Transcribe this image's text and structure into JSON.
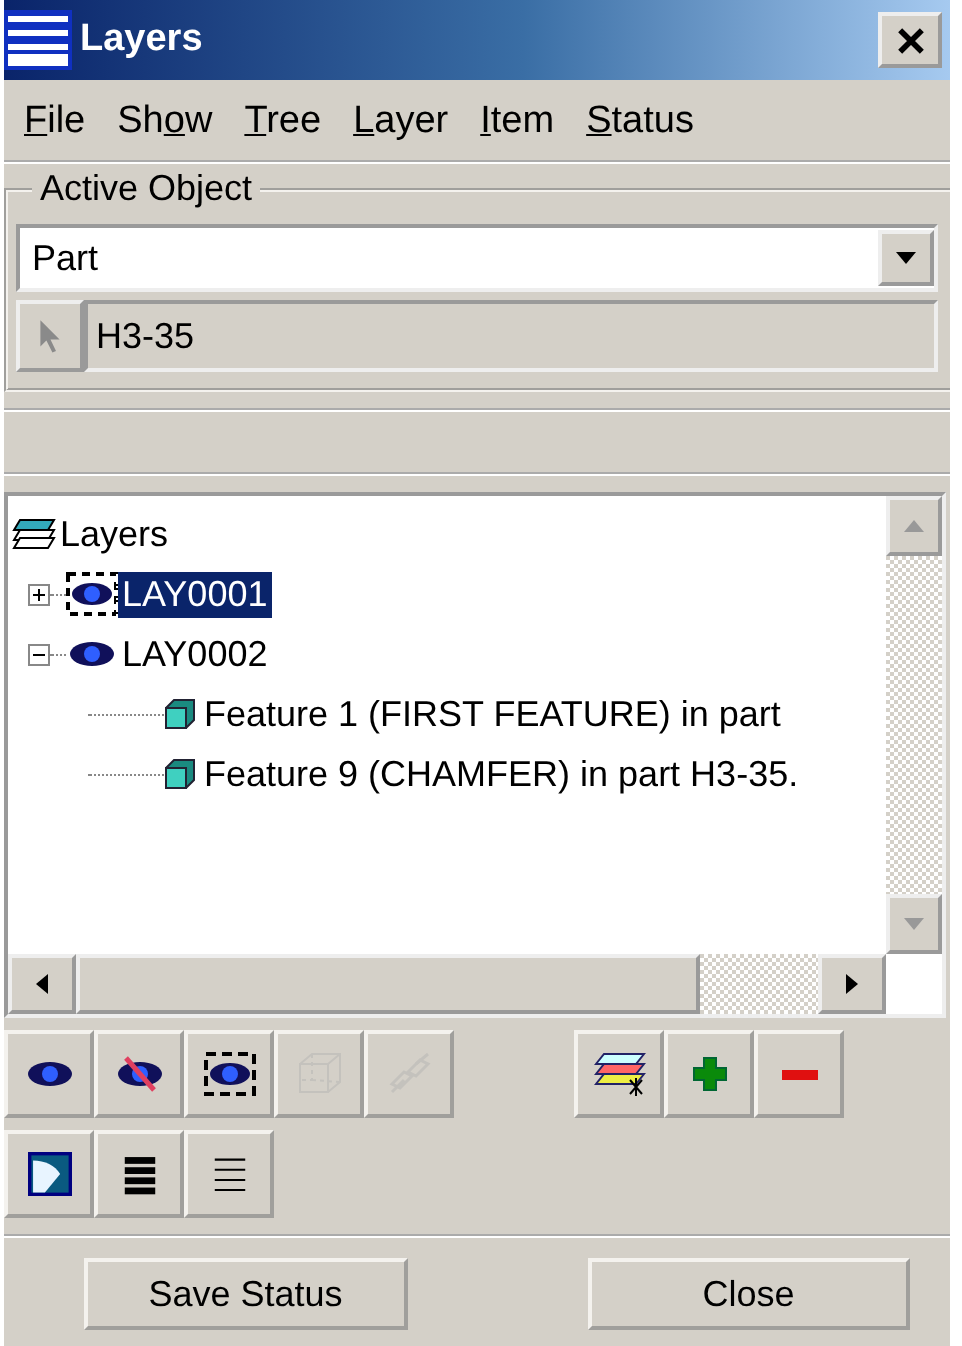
{
  "window": {
    "title": "Layers"
  },
  "menu": [
    {
      "key": "F",
      "post": "ile"
    },
    {
      "pre": "Sh",
      "key": "o",
      "post": "w"
    },
    {
      "key": "T",
      "post": "ree"
    },
    {
      "key": "L",
      "post": "ayer"
    },
    {
      "key": "I",
      "post": "tem"
    },
    {
      "key": "S",
      "post": "tatus"
    }
  ],
  "active_object": {
    "legend": "Active Object",
    "type_value": "Part",
    "name_value": "H3-35"
  },
  "tree": {
    "label": "Layers",
    "children": [
      {
        "label": "LAY0001",
        "selected": true,
        "expanded": false,
        "current": true
      },
      {
        "label": "LAY0002",
        "selected": false,
        "expanded": true,
        "current": false,
        "children": [
          {
            "label": "Feature 1 (FIRST FEATURE) in part",
            "selected": false
          },
          {
            "label": "Feature 9 (CHAMFER) in part H3-35.",
            "selected": false
          }
        ]
      }
    ]
  },
  "toolbar": {
    "row_1_left": [
      {
        "kind": "show",
        "disabled": false
      },
      {
        "kind": "hide",
        "disabled": false
      },
      {
        "kind": "current",
        "disabled": false
      },
      {
        "kind": "box",
        "disabled": true
      },
      {
        "kind": "link",
        "disabled": true
      }
    ],
    "row_1_right": [
      {
        "kind": "new_layer",
        "disabled": false
      },
      {
        "kind": "add",
        "disabled": false
      },
      {
        "kind": "remove",
        "disabled": false
      }
    ],
    "row_2": [
      {
        "kind": "panel",
        "disabled": false
      },
      {
        "kind": "thick",
        "disabled": false
      },
      {
        "kind": "thin",
        "disabled": false
      }
    ]
  },
  "buttons": [
    {
      "label": "Save Status"
    },
    {
      "label": "Close"
    }
  ]
}
